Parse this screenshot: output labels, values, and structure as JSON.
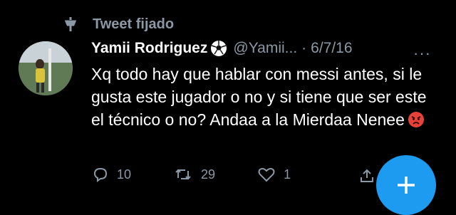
{
  "pinned": {
    "label": "Tweet fijado",
    "icon": "pin-icon"
  },
  "tweet": {
    "author_name": "Yamii Rodriguez",
    "badge_icon": "soccer-ball-icon",
    "handle": "@Yamii...",
    "separator": "·",
    "date": "6/7/16",
    "more_label": "···",
    "text": "Xq todo hay que hablar con messi antes, si le gusta este jugador o no y si tiene que ser este el técnico o no? Andaa a la Mierdaa Nenee",
    "emoji": "angry-face-icon"
  },
  "actions": {
    "reply_count": "10",
    "retweet_count": "29",
    "like_count": "1"
  },
  "fab": {
    "icon": "plus-icon"
  },
  "colors": {
    "accent": "#1d9bf0",
    "muted": "#8b98a5",
    "background": "#000000"
  }
}
